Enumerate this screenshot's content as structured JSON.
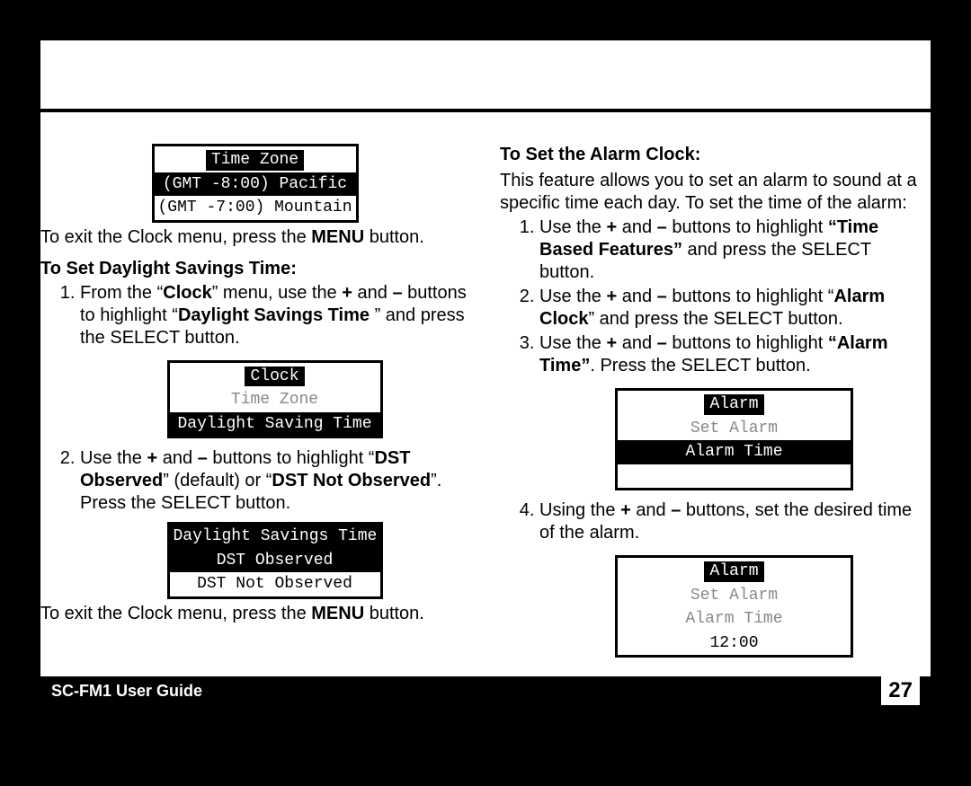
{
  "left": {
    "lcd1": {
      "title": "Time Zone",
      "row1": "(GMT -8:00) Pacific",
      "row2": "(GMT -7:00) Mountain"
    },
    "exit1_pre": "To exit the Clock menu, press the ",
    "exit1_bold": "MENU",
    "exit1_post": " button.",
    "subhead1": "To Set Daylight Savings Time:",
    "step1a": "From the “",
    "step1b": "Clock",
    "step1c": "” menu, use the ",
    "step1d": "+ ",
    "step1e": "and ",
    "step1f": "–",
    "step1g": " buttons to highlight “",
    "step1h": "Daylight Savings Time ",
    "step1i": "” and press the SELECT button.",
    "lcd2": {
      "title": "Clock",
      "row1": "Time Zone",
      "row2": "Daylight Saving Time"
    },
    "step2a": "Use the  ",
    "step2b": "+ ",
    "step2c": "and ",
    "step2d": "–",
    "step2e": " buttons to highlight “",
    "step2f": "DST Observed",
    "step2g": "” (default) or “",
    "step2h": "DST Not Observed",
    "step2i": "”. Press the SELECT button.",
    "lcd3": {
      "title": "Daylight Savings Time",
      "row1": "DST Observed",
      "row2": "DST Not Observed"
    },
    "exit2_pre": "To exit the Clock menu, press the ",
    "exit2_bold": "MENU",
    "exit2_post": " button."
  },
  "right": {
    "subhead1": "To Set the Alarm Clock:",
    "intro": "This feature allows you to set an alarm to sound at a specific time each day. To set the time of the alarm:",
    "step1a": "Use the  ",
    "step1b": "+ ",
    "step1c": "and ",
    "step1d": "–",
    "step1e": " buttons to highlight ",
    "step1f": "“Time Based Features”",
    "step1g": " and press the SELECT button.",
    "step2a": "Use the ",
    "step2b": "+ ",
    "step2c": "and ",
    "step2d": "–",
    "step2e": " buttons to highlight “",
    "step2f": "Alarm Clock",
    "step2g": "” and press the SELECT button.",
    "step3a": "Use the ",
    "step3b": "+ ",
    "step3c": "and ",
    "step3d": "–",
    "step3e": " buttons to highlight ",
    "step3f": "“Alarm Time”",
    "step3g": ". Press the SELECT button.",
    "lcd1": {
      "title": "Alarm",
      "row1": "Set Alarm",
      "row2": "Alarm Time",
      "row3": ""
    },
    "step4a": "Using the ",
    "step4b": "+ ",
    "step4c": "and ",
    "step4d": "–",
    "step4e": " buttons, set the desired time of the alarm.",
    "lcd2": {
      "title": "Alarm",
      "row1": "Set Alarm",
      "row2": "Alarm Time",
      "row3": "12:00"
    }
  },
  "footer": {
    "title": "SC-FM1 User Guide",
    "page": "27"
  }
}
